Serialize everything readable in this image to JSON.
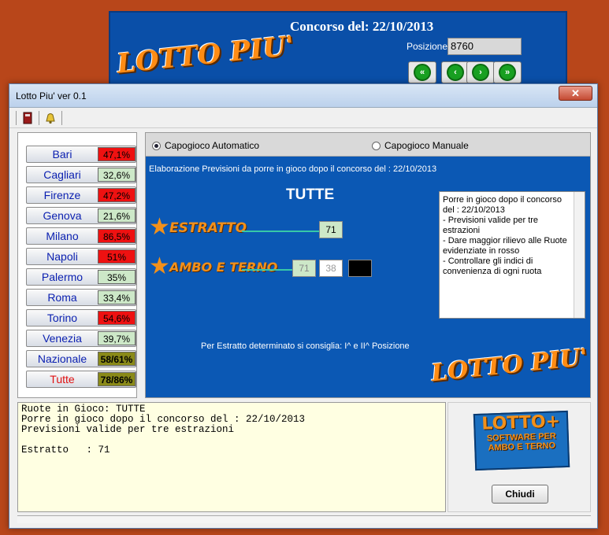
{
  "background_window": {
    "title": "Concorso del:  22/10/2013",
    "position_label": "Posizione :",
    "position_value": "8760",
    "logo": "LOTTO PIU'",
    "nav_buttons": [
      "first",
      "prev",
      "next",
      "last"
    ]
  },
  "window": {
    "title": "Lotto Piu' ver 0.1",
    "close_label": "✕"
  },
  "toolbar": {
    "icons": [
      "book-icon",
      "bell-icon"
    ]
  },
  "ruote": [
    {
      "name": "Bari",
      "value": "47,1%",
      "status": "red"
    },
    {
      "name": "Cagliari",
      "value": "32,6%",
      "status": "green"
    },
    {
      "name": "Firenze",
      "value": "47,2%",
      "status": "red"
    },
    {
      "name": "Genova",
      "value": "21,6%",
      "status": "green"
    },
    {
      "name": "Milano",
      "value": "86,5%",
      "status": "red"
    },
    {
      "name": "Napoli",
      "value": "51%",
      "status": "red"
    },
    {
      "name": "Palermo",
      "value": "35%",
      "status": "green"
    },
    {
      "name": "Roma",
      "value": "33,4%",
      "status": "green"
    },
    {
      "name": "Torino",
      "value": "54,6%",
      "status": "red"
    },
    {
      "name": "Venezia",
      "value": "39,7%",
      "status": "green"
    },
    {
      "name": "Nazionale",
      "value": "58/61%",
      "status": "olive"
    },
    {
      "name": "Tutte",
      "value": "78/86%",
      "status": "olive"
    }
  ],
  "mode": {
    "automatic": "Capogioco Automatico",
    "manual": "Capogioco Manuale",
    "selected": "automatic"
  },
  "elaborazione": "Elaborazione Previsioni da porre in gioco dopo il concorso del :  22/10/2013",
  "ruota_title": "TUTTE",
  "estratto": {
    "label": "ESTRATTO",
    "value": "71"
  },
  "ambo": {
    "label": "AMBO E TERNO",
    "values": [
      "71",
      "38"
    ]
  },
  "memo": {
    "lines": [
      "Porre in gioco dopo il concorso",
      "del : 22/10/2013",
      "- Previsioni valide per tre estrazioni",
      "- Dare maggior rilievo alle Ruote",
      "evidenziate in rosso",
      "- Controllare gli indici di",
      "convenienza di ogni ruota"
    ]
  },
  "consiglio": "Per Estratto determinato si consiglia:  I^ e II^ Posizione",
  "panel_logo": "LOTTO PIU'",
  "output": {
    "lines": [
      "Ruote in Gioco: TUTTE",
      "Porre in gioco dopo il concorso del : 22/10/2013",
      "Previsioni valide per tre estrazioni",
      "",
      "Estratto   : 71"
    ]
  },
  "side_logo": {
    "title": "LOTTO+",
    "line1": "SOFTWARE PER",
    "line2": "AMBO E TERNO"
  },
  "chiudi_label": "Chiudi",
  "colors": {
    "panel_blue": "#0b58b4",
    "red": "#ee1111",
    "green": "#cde8c8",
    "olive": "#8a8a18",
    "accent_orange": "#f2901a"
  }
}
